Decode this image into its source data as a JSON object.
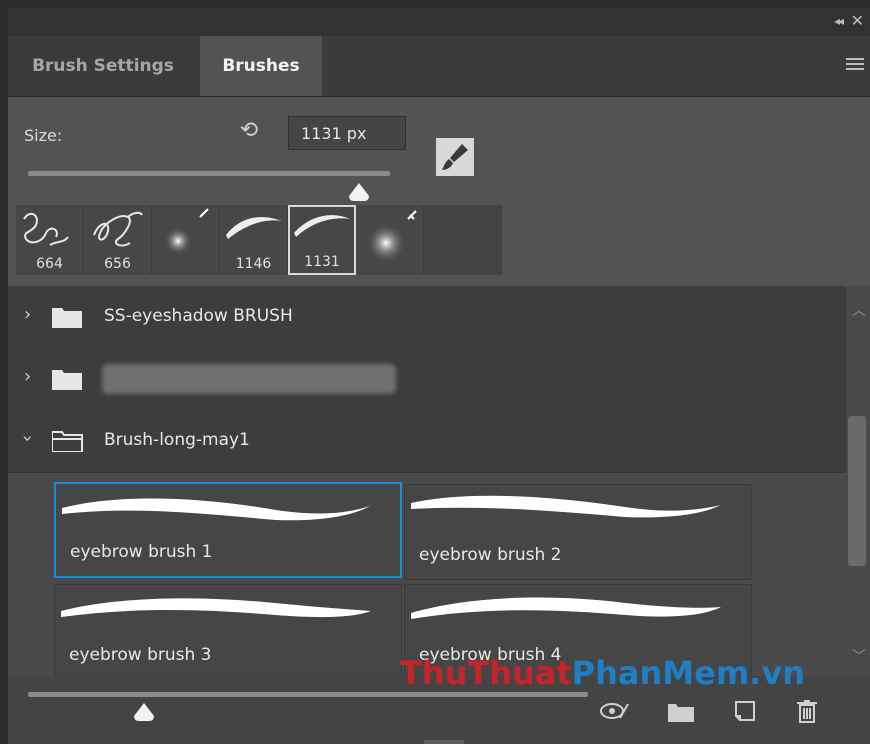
{
  "header": {
    "collapse_icon": "double-chevron-left-icon",
    "close_icon": "close-icon"
  },
  "tabs": [
    {
      "label": "Brush Settings"
    },
    {
      "label": "Brushes"
    }
  ],
  "size": {
    "label": "Size:",
    "value": "1131 px",
    "slider_fraction": 0.93
  },
  "recent_brushes": [
    {
      "size": "664",
      "icon": "swirl-brush-icon"
    },
    {
      "size": "656",
      "icon": "swirl-brush-icon"
    },
    {
      "size": "",
      "icon": "soft-round-brush-icon"
    },
    {
      "size": "1146",
      "icon": "eyebrow-brush-icon"
    },
    {
      "size": "1131",
      "icon": "eyebrow-brush-icon",
      "selected": true
    },
    {
      "size": "",
      "icon": "soft-round-brush-icon"
    }
  ],
  "folders": [
    {
      "name": "SS-eyeshadow BRUSH",
      "expanded": false
    },
    {
      "name": "",
      "expanded": false,
      "blurred": true
    },
    {
      "name": "Brush-long-may1",
      "expanded": true
    }
  ],
  "brushes": [
    {
      "name": "eyebrow brush 1",
      "selected": true
    },
    {
      "name": "eyebrow brush 2"
    },
    {
      "name": "eyebrow brush 3"
    },
    {
      "name": "eyebrow brush 4"
    }
  ],
  "preview_slider_fraction": 0.2,
  "watermark": {
    "part1": "ThuThuat",
    "part2": "PhanMem",
    "part3": ".vn"
  },
  "colors": {
    "accent": "#1a8ed4",
    "panel": "#535353",
    "watermark_red": "#c8222a",
    "watermark_blue": "#1f7fc4"
  }
}
